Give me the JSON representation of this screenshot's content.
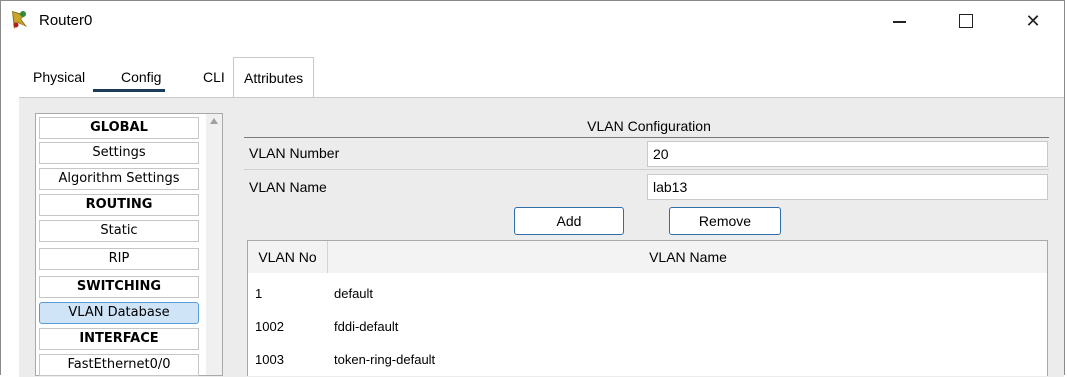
{
  "window": {
    "title": "Router0",
    "icon": "router-icon",
    "controls": [
      "minimize-icon",
      "maximize-icon",
      "close-icon"
    ]
  },
  "tabs": [
    {
      "label": "Physical"
    },
    {
      "label": "Config",
      "active": true
    },
    {
      "label": "CLI"
    },
    {
      "label": "Attributes"
    }
  ],
  "sidebar": {
    "items": [
      {
        "label": "GLOBAL",
        "header": true
      },
      {
        "label": "Settings"
      },
      {
        "label": "Algorithm Settings"
      },
      {
        "label": "ROUTING",
        "header": true
      },
      {
        "label": "Static"
      },
      {
        "label": "RIP"
      },
      {
        "label": "SWITCHING",
        "header": true
      },
      {
        "label": "VLAN Database",
        "selected": true
      },
      {
        "label": "INTERFACE",
        "header": true
      },
      {
        "label": "FastEthernet0/0"
      }
    ]
  },
  "vlan": {
    "section_title": "VLAN Configuration",
    "number_label": "VLAN Number",
    "number_value": "20",
    "name_label": "VLAN Name",
    "name_value": "lab13",
    "add_label": "Add",
    "remove_label": "Remove",
    "table": {
      "headers": [
        "VLAN No",
        "VLAN Name"
      ],
      "rows": [
        {
          "no": "1",
          "name": "default"
        },
        {
          "no": "1002",
          "name": "fddi-default"
        },
        {
          "no": "1003",
          "name": "token-ring-default"
        }
      ]
    }
  },
  "colors": {
    "accent": "#1c3a5c",
    "selected_bg": "#cfe4f7",
    "button_border": "#2f6ea8"
  }
}
